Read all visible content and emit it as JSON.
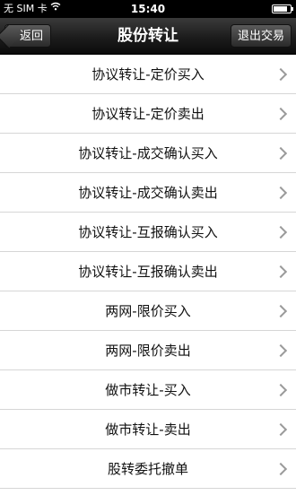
{
  "status_bar": {
    "carrier": "无 SIM 卡",
    "wifi_icon": "wifi-icon",
    "time": "15:40",
    "battery_level": 0.85
  },
  "nav": {
    "back_label": "返回",
    "title": "股份转让",
    "exit_label": "退出交易"
  },
  "menu": {
    "items": [
      {
        "label": "协议转让-定价买入"
      },
      {
        "label": "协议转让-定价卖出"
      },
      {
        "label": "协议转让-成交确认买入"
      },
      {
        "label": "协议转让-成交确认卖出"
      },
      {
        "label": "协议转让-互报确认买入"
      },
      {
        "label": "协议转让-互报确认卖出"
      },
      {
        "label": "两网-限价买入"
      },
      {
        "label": "两网-限价卖出"
      },
      {
        "label": "做市转让-买入"
      },
      {
        "label": "做市转让-卖出"
      },
      {
        "label": "股转委托撤单"
      }
    ]
  }
}
